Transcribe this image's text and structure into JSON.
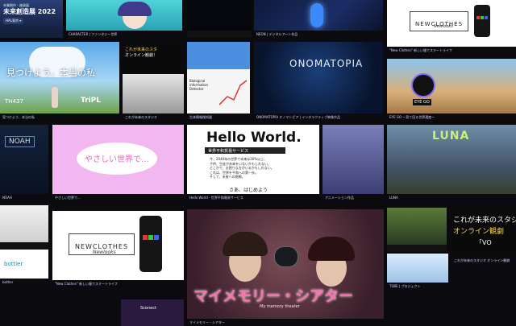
{
  "header": {
    "subtitle": "卒業制作・進級展",
    "title": "未来創造展 2022",
    "location_badge": "HAL東京"
  },
  "tiles": {
    "nc_small": {
      "caption": "\"New Clothes\" 新しい服でスマートライフ",
      "logo": "NEWCLOTHES",
      "script": "Newlooks"
    },
    "hero": {
      "title": "見つけよう、本当の私",
      "team": "TH437",
      "brand": "TriPL",
      "caption": "見つけよう、本当の私"
    },
    "online_small": {
      "text_line1": "これが未来のスタ",
      "text_line2": "オンライン観劇！",
      "caption": "これが未来のスタジオ"
    },
    "bio": {
      "title": "Biological information Detector",
      "caption": "生体情報検知器"
    },
    "onomatopia": {
      "title": "ONOMATOPIA",
      "caption": "ONOMATOPIA オノマトピア | インタラクティブ映像作品"
    },
    "eyego": {
      "label": "EYE GO",
      "caption": "EYE GO ～見て回る世界遺産～"
    },
    "noah": {
      "title": "NOAH",
      "caption": "NOAH"
    },
    "yasashii": {
      "text": "やさしい世界で…",
      "caption": "やさしい世界で…"
    },
    "hello": {
      "title": "Hello World.",
      "subtitle": "世界平和貿易サービス",
      "body_line1": "今、2040年の世界で未来は30%以上、",
      "body_line2": "子供、生徒が未来をいないかもしれない。",
      "body_line3": "どこかで、お困りな方がいるかもしれない。",
      "body_line4": "これは、世界を平和への第一歩。",
      "body_line5": "そして、未来への挑戦。",
      "body_line6": "さあ、はじめよう",
      "caption": "Hello World - 世界平和貿易サービス"
    },
    "luna": {
      "title": "LUNA",
      "caption": "LUNA"
    },
    "nc_big": {
      "logo": "NEWCLOTHES",
      "script": "Newlooks",
      "caption": "\"New Clothes\" 新しい服でスマートライフ"
    },
    "mymemory": {
      "title": "マイメモリー・シアター",
      "subtitle": "My memory theater",
      "caption": "マイメモリー・シアター"
    },
    "online_big": {
      "line1": "これが未来のスタジ",
      "line2": "オンライン観劇",
      "line3": "「VO",
      "caption": "これが未来のスタジオ オンライン観劇"
    },
    "bottler": {
      "brand": "bottler",
      "caption": "bottler"
    },
    "sconect": {
      "brand": "Sconect"
    }
  }
}
